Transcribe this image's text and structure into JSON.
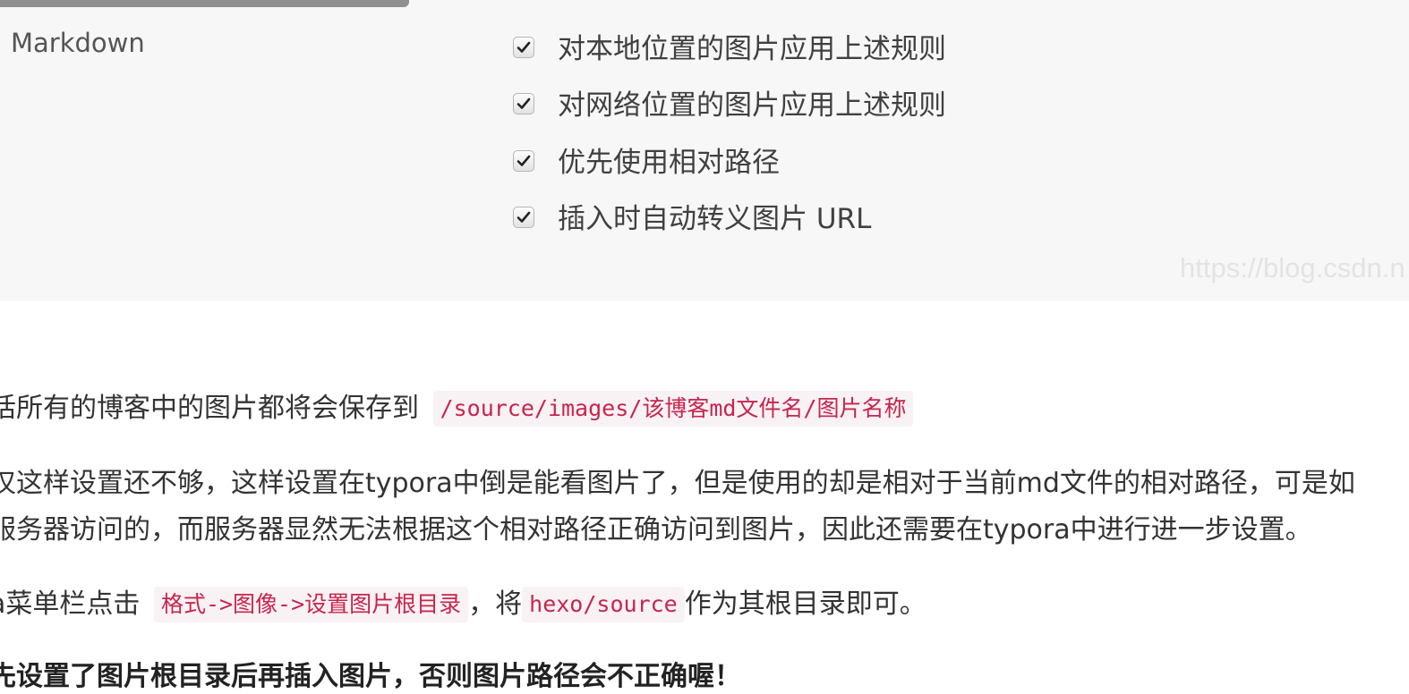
{
  "settings_panel": {
    "sidebar_label": "Markdown",
    "options": [
      {
        "label": "对本地位置的图片应用上述规则",
        "checked": true
      },
      {
        "label": "对网络位置的图片应用上述规则",
        "checked": true
      },
      {
        "label": "优先使用相对路径",
        "checked": true
      },
      {
        "label": "插入时自动转义图片 URL",
        "checked": true
      }
    ],
    "watermark": "https://blog.csdn.n"
  },
  "article": {
    "para1_text": "话所有的博客中的图片都将会保存到",
    "para1_code": "/source/images/该博客md文件名/图片名称",
    "para2_line1": "仅这样设置还不够，这样设置在typora中倒是能看图片了，但是使用的却是相对于当前md文件的相对路径，可是如",
    "para2_line2": "服务器访问的，而服务器显然无法根据这个相对路径正确访问到图片，因此还需要在typora中进行进一步设置。",
    "para3_prefix": "a菜单栏点击",
    "para3_code1": "格式->图像->设置图片根目录",
    "para3_mid": "，将",
    "para3_code2": "hexo/source",
    "para3_suffix": "作为其根目录即可。",
    "para4_bold": "先设置了图片根目录后再插入图片，否则图片路径会不正确喔！"
  },
  "colors": {
    "code_text": "#c7254e",
    "code_bg": "#f9f2f4",
    "panel_bg": "#f7f7f7"
  }
}
